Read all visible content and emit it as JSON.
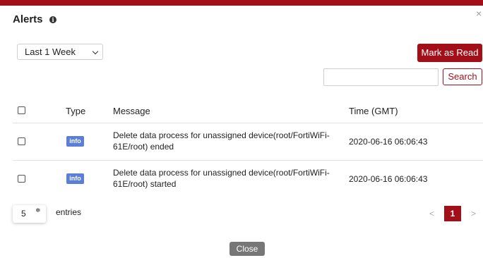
{
  "dialog": {
    "title": "Alerts",
    "info_icon": "i",
    "close_icon": "×"
  },
  "filter": {
    "period": "Last 1 Week"
  },
  "actions": {
    "mark_read": "Mark as Read",
    "search_label": "Search",
    "search_value": ""
  },
  "table": {
    "columns": {
      "type": "Type",
      "message": "Message",
      "time": "Time (GMT)"
    },
    "rows": [
      {
        "type": "info",
        "message_line1": "Delete data process for unassigned device(root/FortiWiFi-",
        "message_line2": "61E/root) ended",
        "time": "2020-06-16 06:06:43"
      },
      {
        "type": "info",
        "message_line1": "Delete data process for unassigned device(root/FortiWiFi-",
        "message_line2": "61E/root) started",
        "time": "2020-06-16 06:06:43"
      }
    ]
  },
  "pagination": {
    "page_size": "5",
    "page_size_arrows": "≑",
    "entries_label": "entries",
    "prev": "<",
    "current": "1",
    "next": ">"
  },
  "footer": {
    "close": "Close"
  },
  "colors": {
    "accent": "#a30f18",
    "info_badge": "#5b7fd9",
    "close_button": "#777777"
  }
}
